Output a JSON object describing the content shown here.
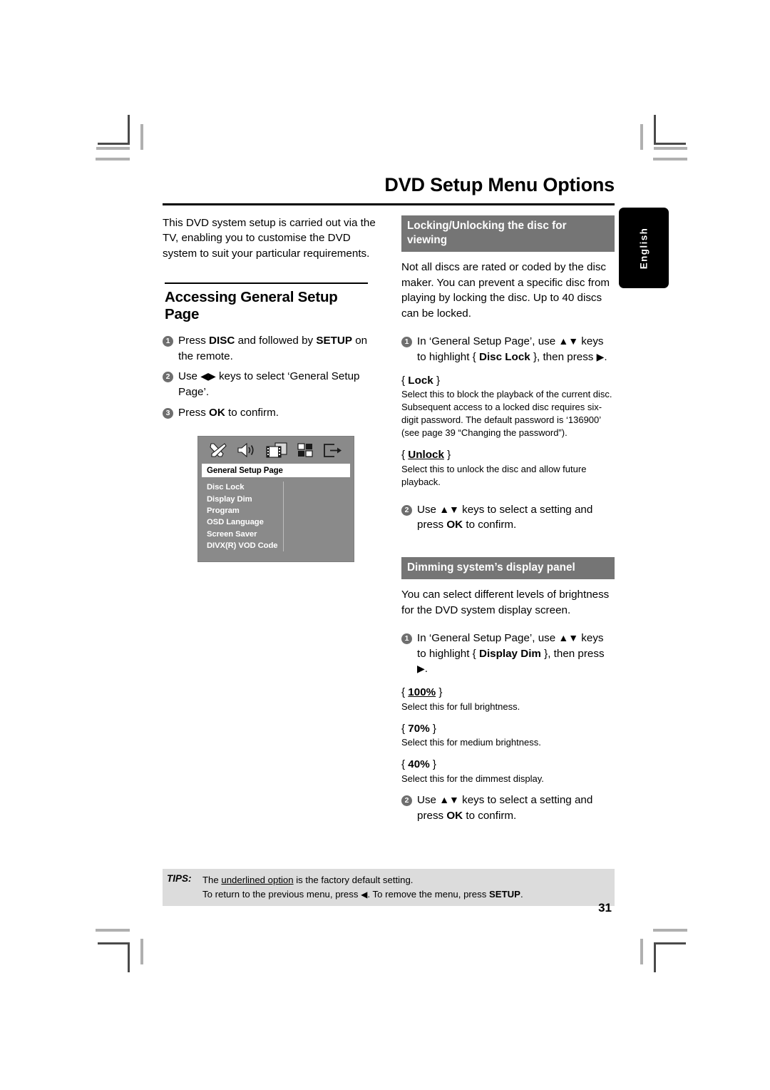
{
  "header": {
    "title": "DVD Setup Menu Options"
  },
  "language_tab": {
    "label": "English"
  },
  "left_column": {
    "intro": "This DVD system setup is carried out via the TV, enabling you to customise the DVD system to suit your particular requirements.",
    "section_heading": "Accessing General Setup Page",
    "steps": [
      {
        "num": "1",
        "html": "Press <b>DISC</b> and followed by <b>SETUP</b> on the remote."
      },
      {
        "num": "2",
        "html": "Use <span class=\"arrow\">◀▶</span> keys to select ‘General Setup Page’."
      },
      {
        "num": "3",
        "html": "Press <b>OK</b> to confirm."
      }
    ]
  },
  "tv_screen": {
    "icons": [
      "tools-icon",
      "speaker-icon",
      "video-icon",
      "preferences-icon",
      "exit-icon"
    ],
    "title": "General Setup Page",
    "menu_items": [
      "Disc Lock",
      "Display Dim",
      "Program",
      "OSD Language",
      "Screen Saver",
      "DIVX(R) VOD Code"
    ]
  },
  "right_column": {
    "section1": {
      "bar": "Locking/Unlocking the disc for viewing",
      "body": "Not all discs are rated or coded by the disc maker. You can prevent a specific disc from playing by locking the disc.  Up to 40 discs can be locked.",
      "step1": {
        "num": "1",
        "html": "In ‘General Setup Page’, use <span class=\"arrow\">▲▼</span> keys to highlight { <b>Disc Lock</b> }, then press <span class=\"arrow\">▶</span>."
      },
      "options": [
        {
          "label": "Lock",
          "underlined": false,
          "desc": "Select this to block the playback of the current disc.  Subsequent access to a locked disc requires six-digit password. The default password is ‘136900’ (see page 39 “Changing the password”)."
        },
        {
          "label": "Unlock",
          "underlined": true,
          "desc": "Select this to unlock the disc and allow future playback."
        }
      ],
      "step2": {
        "num": "2",
        "html": "Use <span class=\"arrow\">▲▼</span> keys to select a setting and press <b>OK</b> to confirm."
      }
    },
    "section2": {
      "bar": "Dimming system’s display panel",
      "body": "You can select different levels of brightness for the DVD system display screen.",
      "step1": {
        "num": "1",
        "html": "In ‘General Setup Page’, use <span class=\"arrow\">▲▼</span> keys to highlight { <b>Display Dim</b> }, then press <span class=\"arrow\">▶</span>."
      },
      "options": [
        {
          "label": "100%",
          "underlined": true,
          "desc": "Select this for full brightness."
        },
        {
          "label": "70%",
          "underlined": false,
          "desc": "Select this for medium brightness."
        },
        {
          "label": "40%",
          "underlined": false,
          "desc": "Select this for the dimmest display."
        }
      ],
      "step2": {
        "num": "2",
        "html": "Use <span class=\"arrow\">▲▼</span> keys to select a setting and press <b>OK</b> to confirm."
      }
    }
  },
  "footer": {
    "tips_label": "TIPS:",
    "tips_line1_html": "The <u>underlined option</u> is the factory default setting.",
    "tips_line2_html": "To return to the previous menu, press <span class=\"arrow\">◀</span>.  To remove the menu, press <b>SETUP</b>.",
    "page_number": "31"
  },
  "colors": {
    "bar_gray": "#757575",
    "tv_gray": "#8a8a8a",
    "tips_gray": "#dcdcdc",
    "bullet_gray": "#6e6e6e",
    "tab_black": "#000000"
  }
}
